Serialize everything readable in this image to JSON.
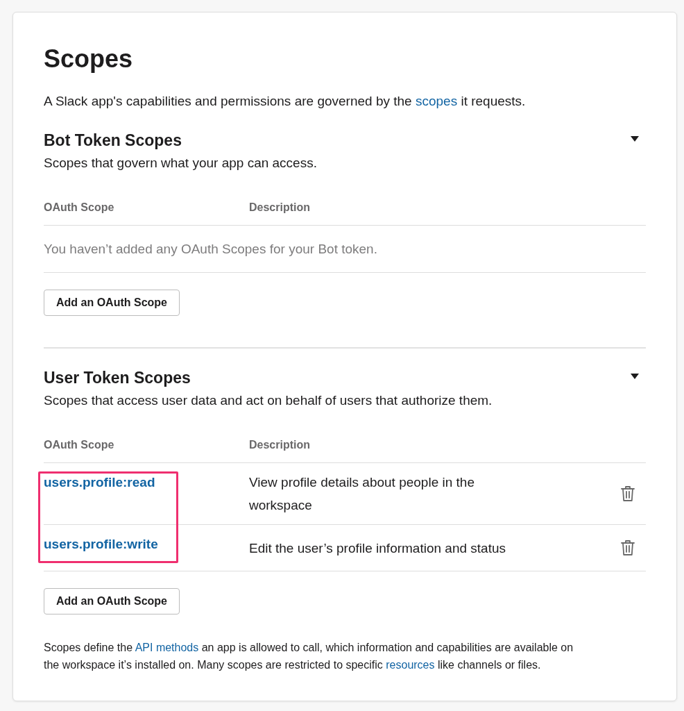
{
  "title": "Scopes",
  "intro": {
    "text_before": "A Slack app's capabilities and permissions are governed by the ",
    "link": "scopes",
    "text_after": " it requests."
  },
  "sections": [
    {
      "title": "Bot Token Scopes",
      "description": "Scopes that govern what your app can access.",
      "expanded": true,
      "columns": [
        "OAuth Scope",
        "Description"
      ],
      "empty_message": "You haven’t added any OAuth Scopes for your Bot token.",
      "add_button": "Add an OAuth Scope"
    },
    {
      "title": "User Token Scopes",
      "description": "Scopes that access user data and act on behalf of users that authorize them.",
      "expanded": true,
      "highlight_scopes": true,
      "columns": [
        "OAuth Scope",
        "Description"
      ],
      "rows": [
        {
          "scope": "users.profile:read",
          "description": "View profile details about people in the workspace"
        },
        {
          "scope": "users.profile:write",
          "description": "Edit the user’s profile information and status"
        }
      ],
      "add_button": "Add an OAuth Scope"
    }
  ],
  "footer": [
    {
      "kind": "text",
      "text": "Scopes define the "
    },
    {
      "kind": "link",
      "text": "API methods"
    },
    {
      "kind": "text",
      "text": " an app is allowed to call, which information and capabilities are available on the workspace it’s installed on. Many scopes are restricted to specific "
    },
    {
      "kind": "link",
      "text": "resources"
    },
    {
      "kind": "text",
      "text": " like channels or files."
    }
  ]
}
